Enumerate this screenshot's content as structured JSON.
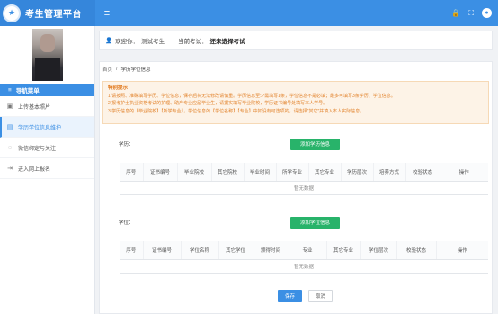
{
  "header": {
    "app_title": "考生管理平台",
    "logo_text": "★",
    "menu_icon": "≡",
    "icons": [
      "lock-icon",
      "fullscreen-icon",
      "user-icon"
    ],
    "lock_glyph": "🔒",
    "expand_glyph": "⛶",
    "user_glyph": "●"
  },
  "sidebar": {
    "nav_title": "导航菜单",
    "nav_title_icon": "≡",
    "items": [
      {
        "label": "上传基本照片",
        "icon": "image-icon",
        "glyph": "▣",
        "active": false
      },
      {
        "label": "学历学位信息维护",
        "icon": "document-icon",
        "glyph": "▤",
        "active": true
      },
      {
        "label": "微信绑定与关注",
        "icon": "chat-icon",
        "glyph": "◌",
        "active": false
      },
      {
        "label": "进入网上报名",
        "icon": "enter-icon",
        "glyph": "⇥",
        "active": false
      }
    ]
  },
  "userbar": {
    "welcome_icon": "👤",
    "welcome_prefix": "欢迎你：",
    "username": "测试考生",
    "exam_prefix": "当前考试：",
    "exam_name": "还未选择考试"
  },
  "breadcrumb": {
    "home": "首页",
    "sep": "/",
    "current": "学历学位信息"
  },
  "notice": {
    "title": "特别提示",
    "lines": [
      "1.请按照、准确填写学历、学位信息，保存后将无法修改请慎重。学历信息至少需填写1条，学位信息不是必填；最多可填写3条学历、学位信息。",
      "2.报考护士执业资格考试的护理、助产专业应届毕业生，请据实填写毕业院校，学历证书编号处填写本人学号。",
      "3.学历信息的【毕业院校】【所学专业】，学位信息的【学位名称】【专业】中如没有可选项的，请选择\"其它\"并填入本人实际信息。"
    ]
  },
  "education": {
    "label": "学历：",
    "add_button": "添加学历信息",
    "columns": [
      "序号",
      "证书编号",
      "毕业院校",
      "其它院校",
      "毕业时间",
      "所学专业",
      "其它专业",
      "学历层次",
      "培养方式",
      "校验状态",
      "操作"
    ],
    "empty_text": "暂无数据"
  },
  "degree": {
    "label": "学位：",
    "add_button": "添加学位信息",
    "columns": [
      "序号",
      "证书编号",
      "学位名称",
      "其它学位",
      "颁得时间",
      "专业",
      "其它专业",
      "学位层次",
      "校验状态",
      "操作"
    ],
    "empty_text": "暂无数据"
  },
  "actions": {
    "save": "保存",
    "cancel": "取消"
  }
}
